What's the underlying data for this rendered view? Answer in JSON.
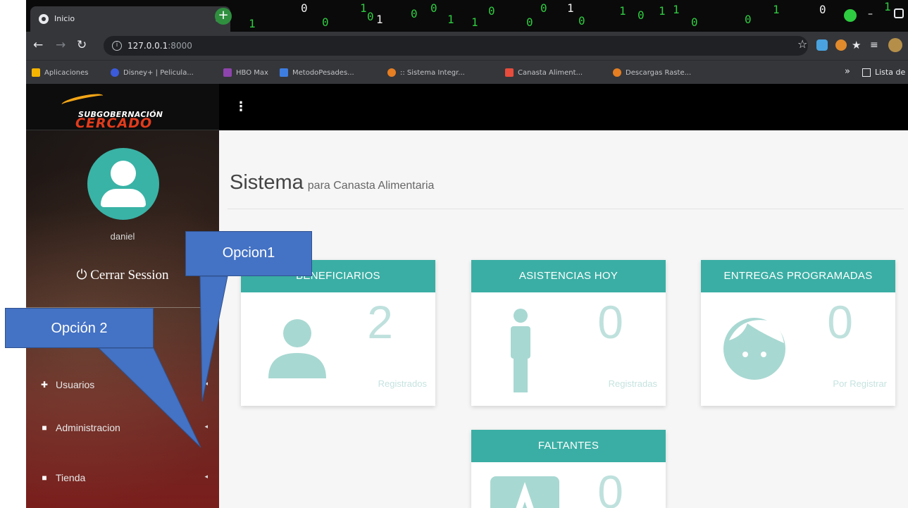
{
  "browser": {
    "tab_title": "Inicio",
    "tab_close": "×",
    "new_tab": "+",
    "url_host": "127.0.0.1",
    "url_port": ":8000",
    "matrix_digits": [
      "1",
      "0",
      "0",
      "1",
      "0",
      "1",
      "0",
      "0",
      "1",
      "0",
      "0",
      "1",
      "0",
      "1",
      "0",
      "1",
      "1",
      "0",
      "0",
      "1",
      "0",
      "1",
      "1",
      "0",
      "1"
    ]
  },
  "bookmarks": [
    {
      "label": "Aplicaciones",
      "color": "#f4b400"
    },
    {
      "label": "Disney+ | Pelicula...",
      "color": "#3b5bdb"
    },
    {
      "label": "HBO Max",
      "color": "#8e44ad"
    },
    {
      "label": "MetodoPesades...",
      "color": "#3d7de0"
    },
    {
      "label": ":: Sistema Integr...",
      "color": "#e67e22"
    },
    {
      "label": "Canasta Aliment...",
      "color": "#e74c3c"
    },
    {
      "label": "Descargas Raste...",
      "color": "#e67e22"
    }
  ],
  "bookmarks_more": "»",
  "reading_list": "Lista de le",
  "logo": {
    "line1": "SUBGOBERNACIÓN",
    "line2": "CERCADO"
  },
  "user": {
    "name": "daniel",
    "logout": "⏻ Cerrar Session"
  },
  "menu": [
    {
      "label": "Usuarios",
      "icon": "users-icon",
      "glyph": "👥"
    },
    {
      "label": "Administracion",
      "icon": "briefcase-icon",
      "glyph": "■"
    },
    {
      "label": "Tienda",
      "icon": "briefcase-icon",
      "glyph": "■"
    }
  ],
  "page": {
    "title": "Sistema",
    "subtitle": "para Canasta Alimentaria"
  },
  "cards": [
    {
      "title": "BENEFICIARIOS",
      "value": "2",
      "caption": "Registrados",
      "icon": "user-icon"
    },
    {
      "title": "ASISTENCIAS HOY",
      "value": "0",
      "caption": "Registradas",
      "icon": "person-standing-icon"
    },
    {
      "title": "ENTREGAS PROGRAMADAS",
      "value": "0",
      "caption": "Por Registrar",
      "icon": "smiley-face-icon"
    },
    {
      "title": "FALTANTES",
      "value": "0",
      "caption": "",
      "icon": "letter-a-icon"
    }
  ],
  "annotations": {
    "opcion1": "Opcion1",
    "opcion2": "Opción 2"
  },
  "colors": {
    "teal": "#3aaea4",
    "callout": "#4472c4",
    "brand_orange": "#f2a516",
    "brand_red": "#e23b1c"
  }
}
